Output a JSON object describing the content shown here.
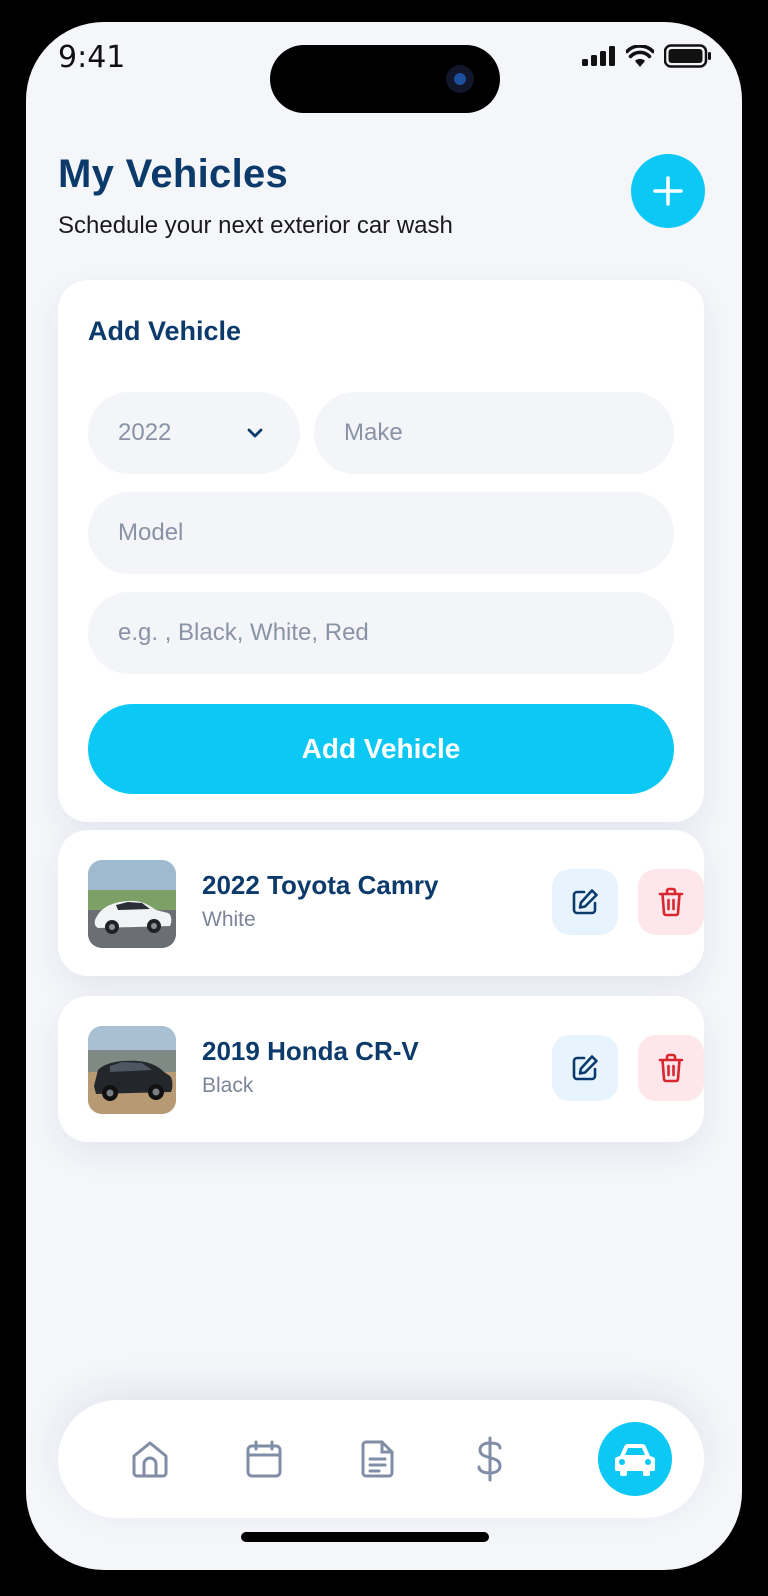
{
  "status_bar": {
    "time": "9:41"
  },
  "header": {
    "title": "My Vehicles",
    "subtitle": "Schedule your next exterior car wash"
  },
  "add_form": {
    "title": "Add Vehicle",
    "year_value": "2022",
    "make_placeholder": "Make",
    "model_placeholder": "Model",
    "color_placeholder": "e.g. , Black, White, Red",
    "submit_label": "Add Vehicle"
  },
  "vehicles": [
    {
      "name": "2022 Toyota Camry",
      "color": "White"
    },
    {
      "name": "2019 Honda CR-V",
      "color": "Black"
    }
  ],
  "nav": {
    "items": [
      "home-icon",
      "calendar-icon",
      "document-icon",
      "dollar-icon",
      "car-icon"
    ],
    "active": "car-icon"
  },
  "colors": {
    "accent": "#0cc8f5",
    "title": "#0b3a6b",
    "edit_bg": "#e7f4fe",
    "delete_bg": "#fde7ea",
    "delete_icon": "#d9262f"
  }
}
